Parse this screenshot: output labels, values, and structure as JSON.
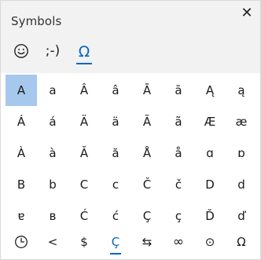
{
  "header": {
    "title": "Symbols",
    "close_label": "✕"
  },
  "tabs": [
    {
      "label": "☺",
      "name": "emoji-icon",
      "active": false
    },
    {
      "label": ";-)",
      "name": "kaomoji",
      "active": false
    },
    {
      "label": "Ω",
      "name": "symbols-omega-icon",
      "active": true
    }
  ],
  "grid": {
    "selected": "A",
    "rows": [
      [
        "A",
        "a",
        "Â",
        "â",
        "Ā",
        "ā",
        "Ą",
        "ą"
      ],
      [
        "Á",
        "á",
        "Ä",
        "ä",
        "Ã",
        "ã",
        "Æ",
        "æ"
      ],
      [
        "À",
        "à",
        "Ă",
        "ă",
        "Å",
        "å",
        "ɑ",
        "ɒ"
      ],
      [
        "B",
        "b",
        "C",
        "c",
        "Č",
        "č",
        "D",
        "d"
      ],
      [
        "ɐ",
        "ʙ",
        "Ć",
        "ć",
        "Ç",
        "ç",
        "Ď",
        "ď"
      ]
    ]
  },
  "categories": [
    {
      "label": "🕒",
      "name": "recent-clock-icon",
      "active": false
    },
    {
      "label": "<",
      "name": "punctuation-category",
      "active": false
    },
    {
      "label": "$",
      "name": "currency-category",
      "active": false
    },
    {
      "label": "Ç",
      "name": "latin-category",
      "active": true
    },
    {
      "label": "⇆",
      "name": "arrows-category",
      "active": false
    },
    {
      "label": "∞",
      "name": "math-category",
      "active": false
    },
    {
      "label": "⊙",
      "name": "supplemental-category",
      "active": false
    },
    {
      "label": "Ω",
      "name": "language-category",
      "active": false
    }
  ],
  "colors": {
    "accent": "#0067c0",
    "selected_bg": "#a6c8ec",
    "header_bg": "#f2f2f2"
  }
}
